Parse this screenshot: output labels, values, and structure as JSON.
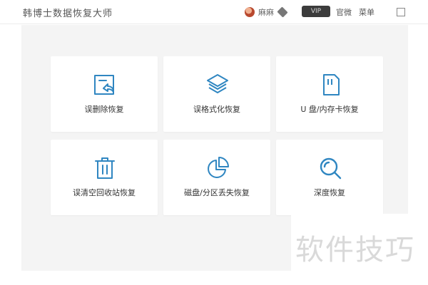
{
  "app": {
    "title": "韩博士数据恢复大师"
  },
  "header": {
    "username": "麻麻",
    "vip_tag": "VIP",
    "menu_settings": "官微",
    "menu_menu": "菜单"
  },
  "cards": [
    {
      "label": "误删除恢复",
      "icon": "delete-recover-icon"
    },
    {
      "label": "误格式化恢复",
      "icon": "layers-icon"
    },
    {
      "label": "U 盘/内存卡恢复",
      "icon": "sd-card-icon"
    },
    {
      "label": "误清空回收站恢复",
      "icon": "trash-icon"
    },
    {
      "label": "磁盘/分区丢失恢复",
      "icon": "pie-chart-icon"
    },
    {
      "label": "深度恢复",
      "icon": "search-icon"
    }
  ],
  "watermark": {
    "text": "软件技巧"
  },
  "colors": {
    "accent": "#2f86c1",
    "background": "#f4f4f4"
  }
}
